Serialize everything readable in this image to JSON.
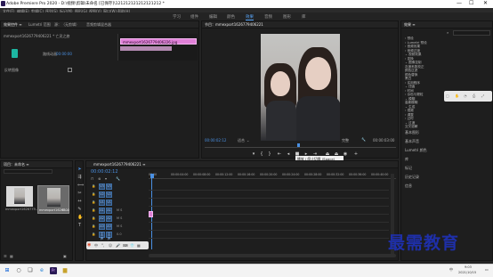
{
  "app": {
    "title": "Adobe Premiere Pro 2020 - D:\\视频\\剪辑\\未命名 [已保存]\\121212121212121212 *"
  },
  "window_controls": {
    "minimize": "—",
    "maximize": "☐",
    "close": "✕"
  },
  "menu": {
    "items": [
      "文件(F)",
      "编辑(E)",
      "剪辑(C)",
      "序列(S)",
      "标记(M)",
      "图形(G)",
      "视图(V)",
      "窗口(W)",
      "帮助(H)"
    ]
  },
  "workspaces": {
    "items": [
      "学习",
      "组件",
      "编辑",
      "颜色",
      "效果",
      "音频",
      "图形",
      "库"
    ],
    "active_index": 4
  },
  "effect_controls": {
    "tabs": [
      "效果控件 ≡",
      "Lumetri 范围",
      "源：（无剪辑）",
      "音频剪辑混合器"
    ],
    "clip_label": "mmexport1626779406221 * 亡灵之旅",
    "toggle_label": "路线动画",
    "sub_label": "00:00:00",
    "property_label": "反转图像",
    "timecode": "00:00:02:12",
    "mini_clip": "mmexport1626779406226.jpg"
  },
  "program_monitor": {
    "tab_label": "节目：mmexport1626779406221",
    "timecode_left": "00:00:02:12",
    "fit_label": "适合",
    "quality_label": "完整",
    "timecode_right": "00:00:03:00",
    "tooltip": "播放 / 停止切换 (Space)"
  },
  "project": {
    "tab_label": "项目：未命名 ≡",
    "search_placeholder": "",
    "items": [
      {
        "name": "mmexport1626779...",
        "duration": ""
      },
      {
        "name": "mmexport16267...",
        "duration": "5:00"
      }
    ]
  },
  "timeline": {
    "tab_label": "mmexport1626779406221 ≡",
    "timecode": "00:00:02:12",
    "ruler_labels": [
      "00:00",
      "00:00:04:00",
      "00:00:08:00",
      "00:00:12:00",
      "00:00:16:00",
      "00:00:20:00",
      "00:00:24:00",
      "00:00:28:00",
      "00:00:32:00",
      "00:00:36:00",
      "00:00:40:00"
    ],
    "tracks": [
      {
        "name": "V3",
        "label": ""
      },
      {
        "name": "V2",
        "label": ""
      },
      {
        "name": "V1",
        "label": ""
      },
      {
        "name": "A1",
        "label": "M S"
      },
      {
        "name": "A2",
        "label": "M S"
      },
      {
        "name": "A3",
        "label": "M S"
      },
      {
        "name": "主声道",
        "label": "0.0"
      }
    ]
  },
  "effects_panel": {
    "title": "效果 ≡",
    "search_value": "",
    "tree": [
      "› 预设",
      "› Lumetri 预设",
      "› 音频效果",
      "› 音频过渡",
      "⌄ 视频效果",
      "› 变换",
      "  ⌄ 图像控制",
      "    灰度系数校正",
      "    颜色过滤",
      "    颜色替换",
      "    黑白",
      "› 实用程序",
      "⌄ 扭曲",
      "› 时间",
      "› 杂色与颗粒",
      "⌄ 模糊",
      "    高斯模糊",
      "⌄ 生成",
      "› 视频",
      "› 调整",
      "› 过时",
      "⌄ 过渡",
      "    交叉溶解"
    ],
    "sections": [
      "基本图形",
      "基本声音",
      "Lumetri 颜色",
      "库",
      "标记",
      "历史记录",
      "信息"
    ]
  },
  "watermark": {
    "text": "最需教育"
  },
  "taskbar": {
    "clock_time": "9:03",
    "clock_date": "2021/10/15",
    "lang": "中"
  }
}
